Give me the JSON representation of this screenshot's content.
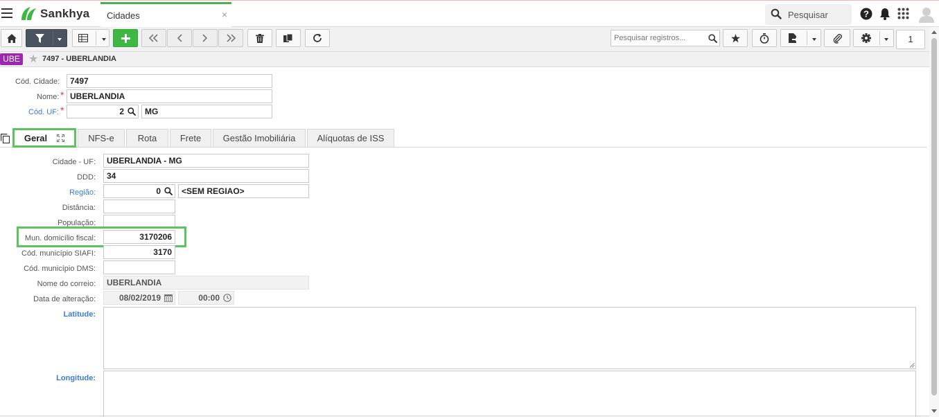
{
  "app": {
    "brand": "Sankhya",
    "tab_title": "Cidades",
    "tab_close": "×",
    "search_placeholder": "Pesquisar"
  },
  "toolbar": {
    "search_placeholder": "Pesquisar registros...",
    "page_number": "1"
  },
  "record": {
    "badge": "UBE",
    "title": "7497 - UBERLANDIA"
  },
  "header_form": {
    "cod_cidade_label": "Cód. Cidade:",
    "cod_cidade_value": "7497",
    "nome_label": "Nome:",
    "nome_value": "UBERLANDIA",
    "cod_uf_label": "Cód. UF:",
    "cod_uf_value": "2",
    "uf_desc": "MG",
    "required_mark": "*"
  },
  "tabs": [
    {
      "label": "Geral"
    },
    {
      "label": "NFS-e"
    },
    {
      "label": "Rota"
    },
    {
      "label": "Frete"
    },
    {
      "label": "Gestão Imobiliária"
    },
    {
      "label": "Alíquotas de ISS"
    }
  ],
  "geral": {
    "cidade_uf_label": "Cidade - UF:",
    "cidade_uf_value": "UBERLANDIA - MG",
    "ddd_label": "DDD:",
    "ddd_value": "34",
    "regiao_label": "Região:",
    "regiao_code": "0",
    "regiao_desc": "<SEM REGIAO>",
    "distancia_label": "Distância:",
    "distancia_value": "",
    "populacao_label": "População:",
    "populacao_value": "",
    "mun_fiscal_label": "Mun. domicílio fiscal:",
    "mun_fiscal_value": "3170206",
    "siafi_label": "Cód. município SIAFI:",
    "siafi_value": "3170",
    "dms_label": "Cód. município DMS:",
    "dms_value": "",
    "correio_label": "Nome do correio:",
    "correio_value": "UBERLANDIA",
    "data_alt_label": "Data de alteração:",
    "data_alt_date": "08/02/2019",
    "data_alt_time": "00:00",
    "latitude_label": "Latitude:",
    "longitude_label": "Longitude:"
  },
  "colors": {
    "accent_green": "#3db843",
    "highlight_green": "#5cc45c",
    "badge_purple": "#9c27b0",
    "link_blue": "#3a7bd5",
    "filter_dark": "#4a5460"
  },
  "icons": [
    "menu-icon",
    "sankhya-logo-icon",
    "search-icon",
    "help-icon",
    "bell-icon",
    "apps-grid-icon",
    "user-avatar-icon",
    "home-icon",
    "filter-icon",
    "grid-view-icon",
    "plus-icon",
    "first-record-icon",
    "prev-record-icon",
    "next-record-icon",
    "last-record-icon",
    "trash-icon",
    "duplicate-icon",
    "refresh-icon",
    "favorite-star-icon",
    "timer-icon",
    "export-icon",
    "paperclip-icon",
    "gear-icon",
    "calendar-icon",
    "clock-icon",
    "expand-icon",
    "copy-tabs-icon"
  ]
}
